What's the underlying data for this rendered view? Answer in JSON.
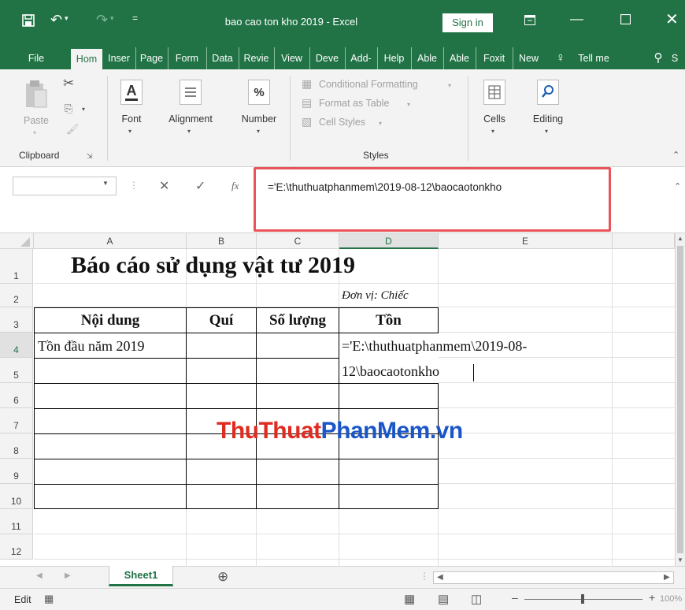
{
  "window": {
    "title": "bao cao ton kho 2019  -  Excel",
    "sign_in": "Sign in"
  },
  "tabs": [
    "File",
    "Hom",
    "Inser",
    "Page",
    "Form",
    "Data",
    "Revie",
    "View",
    "Deve",
    "Add-",
    "Help",
    "Able",
    "Able",
    "Foxit",
    "New",
    "Tell me",
    "S"
  ],
  "ribbon": {
    "paste": "Paste",
    "clipboard": "Clipboard",
    "font": "Font",
    "alignment": "Alignment",
    "number": "Number",
    "conditional_formatting": "Conditional Formatting",
    "format_as_table": "Format as Table",
    "cell_styles": "Cell Styles",
    "styles": "Styles",
    "cells": "Cells",
    "editing": "Editing"
  },
  "formula_bar": {
    "name_box": "",
    "fx": "fx",
    "formula": "='E:\\thuthuatphanmem\\2019-08-12\\baocaotonkho"
  },
  "columns": [
    "A",
    "B",
    "C",
    "D",
    "E"
  ],
  "rows": [
    "1",
    "2",
    "3",
    "4",
    "5",
    "6",
    "7",
    "8",
    "9",
    "10",
    "11",
    "12"
  ],
  "sheet": {
    "title": "Báo cáo sử dụng vật tư 2019",
    "unit": "Đơn vị: Chiếc",
    "headers": [
      "Nội dung",
      "Quí",
      "Số lượng",
      "Tồn"
    ],
    "a4": "Tồn đầu năm 2019",
    "d4_line1": "='E:\\thuthuatphanmem\\2019-08-",
    "d4_line2": "12\\baocaotonkho"
  },
  "watermark": {
    "part1": "Thu",
    "part2": "Thuat",
    "part3": "PhanMem",
    "part4": ".vn"
  },
  "sheet_tabs": [
    "Sheet1"
  ],
  "status": {
    "mode": "Edit",
    "zoom": "100%"
  },
  "colors": {
    "excel_green": "#217346",
    "highlight_red": "#e8545a",
    "watermark_red": "#e02b20",
    "watermark_blue": "#1a56c7"
  }
}
